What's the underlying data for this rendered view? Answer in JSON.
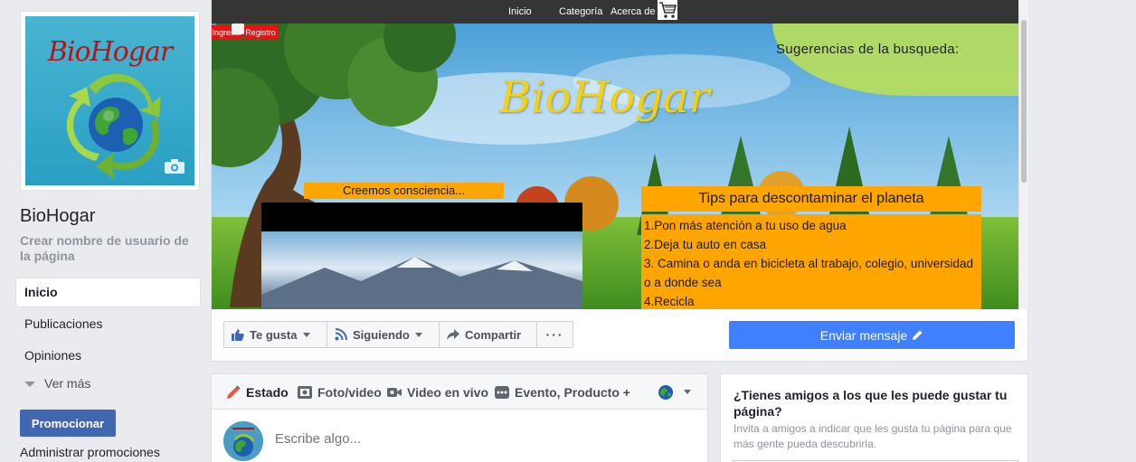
{
  "sidebar": {
    "profile_logo_text": "BioHogar",
    "page_name": "BioHogar",
    "username_link": "Crear nombre de usuario de la página",
    "nav": {
      "inicio": "Inicio",
      "publicaciones": "Publicaciones",
      "opiniones": "Opiniones"
    },
    "ver_mas": "Ver más",
    "promote_button": "Promocionar",
    "manage_promotions": "Administrar promociones"
  },
  "cover": {
    "site_nav": {
      "inicio": "Inicio",
      "categoria": "Categoría",
      "acerca_de": "Acerca de"
    },
    "ingresar": "Ingresar",
    "registro": "Registro",
    "suggestions": "Sugerencias de la busqueda:",
    "title": "BioHogar",
    "creemos": "Creemos consciencia...",
    "tips_header": "Tips para descontaminar el planeta",
    "tips_text": "1.Pon más atención a tu uso de agua\n2.Deja tu auto en casa\n3. Camina o anda en bicicleta al trabajo, colegio, universidad o a donde sea\n4.Recicla"
  },
  "actions": {
    "like": "Te gusta",
    "follow": "Siguiendo",
    "share": "Compartir",
    "more": "···",
    "message": "Enviar mensaje"
  },
  "composer": {
    "tabs": {
      "estado": "Estado",
      "foto": "Foto/video",
      "video": "Video en vivo",
      "evento": "Evento, Producto +"
    },
    "placeholder": "Escribe algo..."
  },
  "invite": {
    "title": "¿Tienes amigos a los que les puede gustar tu página?",
    "description": "Invita a amigos a indicar que les gusta tu página para que más gente pueda descubrirla."
  },
  "colors": {
    "facebook_blue": "#4267b2",
    "message_blue": "#4080ff",
    "tips_orange": "#ffa500",
    "title_yellow": "#f4d20e",
    "login_red": "#e81212"
  }
}
